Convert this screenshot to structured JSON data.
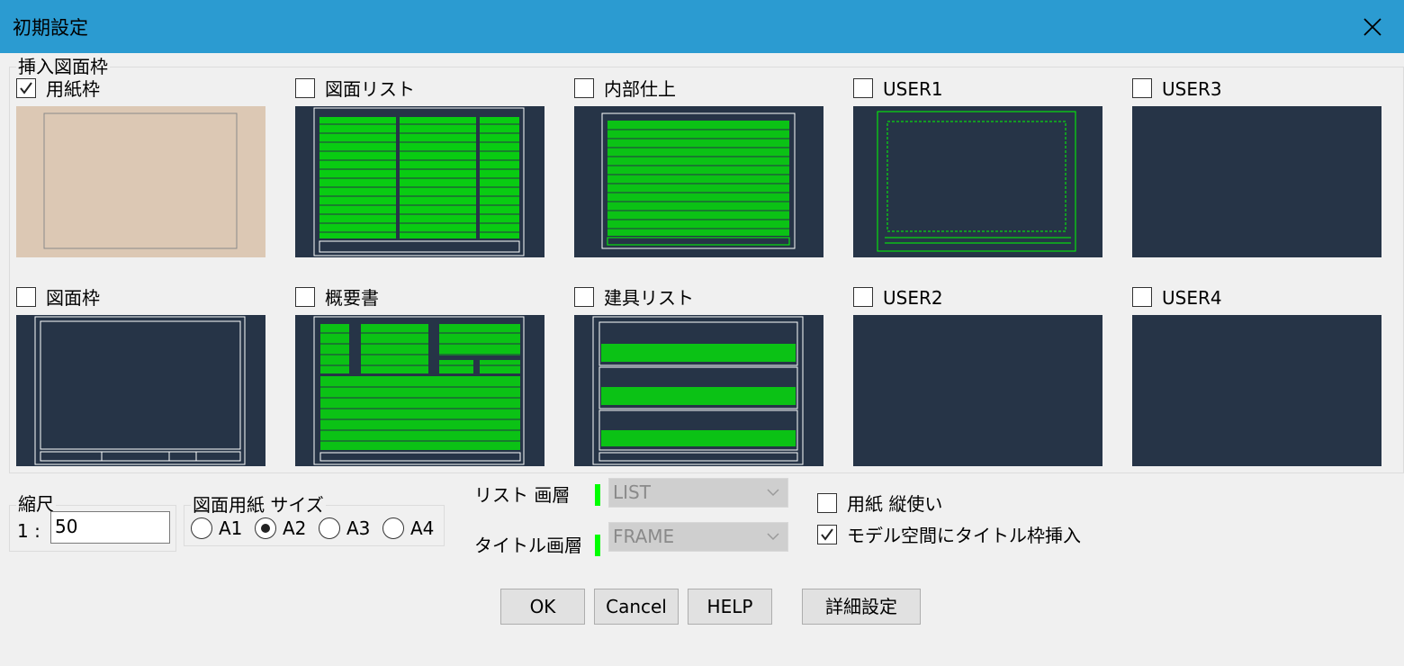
{
  "window": {
    "title": "初期設定"
  },
  "frame_group": {
    "label": "挿入図面枠",
    "items": [
      {
        "label": "用紙枠",
        "checked": true
      },
      {
        "label": "図面リスト",
        "checked": false
      },
      {
        "label": "内部仕上",
        "checked": false
      },
      {
        "label": "USER1",
        "checked": false
      },
      {
        "label": "USER3",
        "checked": false
      },
      {
        "label": "図面枠",
        "checked": false
      },
      {
        "label": "概要書",
        "checked": false
      },
      {
        "label": "建具リスト",
        "checked": false
      },
      {
        "label": "USER2",
        "checked": false
      },
      {
        "label": "USER4",
        "checked": false
      }
    ]
  },
  "scale": {
    "label": "縮尺",
    "prefix": "1 :",
    "value": "50"
  },
  "paper_size": {
    "label": "図面用紙 サイズ",
    "options": [
      "A1",
      "A2",
      "A3",
      "A4"
    ],
    "selected": "A2"
  },
  "layers": {
    "list_label": "リスト 画層",
    "list_value": "LIST",
    "title_label": "タイトル画層",
    "title_value": "FRAME",
    "marker_color": "#00ff00"
  },
  "options": {
    "portrait": {
      "label": "用紙 縦使い",
      "checked": false
    },
    "model_space_title": {
      "label": "モデル空間にタイトル枠挿入",
      "checked": true
    }
  },
  "buttons": {
    "ok": "OK",
    "cancel": "Cancel",
    "help": "HELP",
    "details": "詳細設定"
  },
  "colors": {
    "titlebar": "#2b9bd1",
    "thumb_bg": "#263447",
    "paper_thumb_bg": "#dcc8b4",
    "cad_green": "#00ff00"
  }
}
